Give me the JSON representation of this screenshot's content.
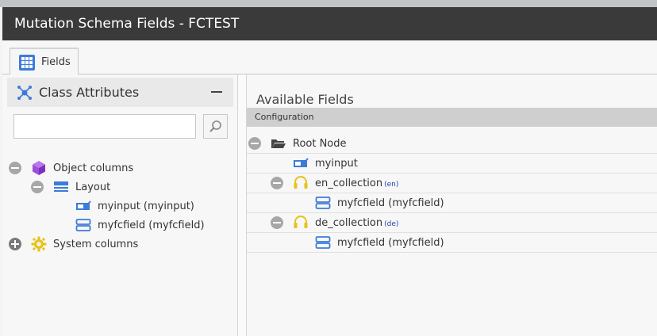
{
  "window": {
    "title": "Mutation Schema Fields - FCTEST"
  },
  "tabs": [
    {
      "label": "Fields",
      "icon": "grid-icon"
    }
  ],
  "left_panel": {
    "title": "Class Attributes",
    "search": {
      "value": "",
      "placeholder": ""
    },
    "tree": [
      {
        "label": "Object columns",
        "icon": "cube-icon",
        "expanded": true
      },
      {
        "label": "Layout",
        "icon": "layout-icon",
        "expanded": true
      },
      {
        "label": "myinput (myinput)",
        "icon": "input-icon"
      },
      {
        "label": "myfcfield (myfcfield)",
        "icon": "fieldcollection-icon"
      },
      {
        "label": "System columns",
        "icon": "gear-icon",
        "expanded": false
      }
    ]
  },
  "right_panel": {
    "title": "Available Fields",
    "column_header": "Configuration",
    "rows": [
      {
        "label": "Root Node",
        "icon": "folder-open-icon"
      },
      {
        "label": "myinput",
        "icon": "input-icon"
      },
      {
        "label": "en_collection",
        "tag": "(en)",
        "icon": "headset-icon"
      },
      {
        "label": "myfcfield (myfcfield)",
        "icon": "fieldcollection-icon"
      },
      {
        "label": "de_collection",
        "tag": "(de)",
        "icon": "headset-icon"
      },
      {
        "label": "myfcfield (myfcfield)",
        "icon": "fieldcollection-icon"
      }
    ]
  },
  "colors": {
    "titlebar": "#3a3a3a",
    "accent_blue": "#3d7bd8",
    "cube_purple": "#9c4fd8",
    "gear_yellow": "#e6c21a"
  }
}
